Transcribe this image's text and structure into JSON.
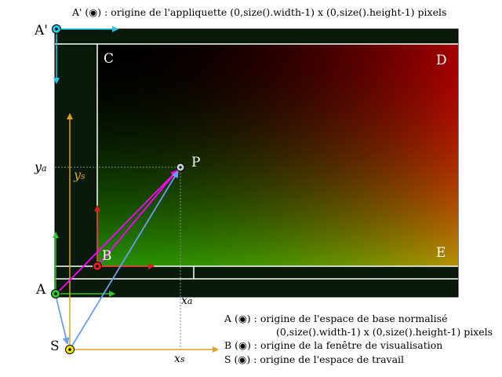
{
  "caption_top": "A' (◉) : origine de l'appliquette  (0,size().width-1) x (0,size().height-1) pixels",
  "points": {
    "A_prime": "A'",
    "A": "A",
    "B": "B",
    "C": "C",
    "D": "D",
    "E": "E",
    "P": "P",
    "S": "S"
  },
  "axes": {
    "ya": "y",
    "ya_sub": "a",
    "ys": "y",
    "ys_sub": "s",
    "xa": "x",
    "xa_sub": "a",
    "xs": "x",
    "xs_sub": "s"
  },
  "legend": {
    "line1": "A  (◉) : origine de l'espace de base normalisé",
    "line2": "(0,size().width-1) x (0,size().height-1) pixels",
    "line3": "B  (◉) : origine de la fenêtre de visualisation",
    "line4": "S  (◉) : origine de l'espace de travail"
  },
  "colors": {
    "cyan": "#22c8e6",
    "green": "#2ec82e",
    "red": "#e02020",
    "yellow": "#f2e600",
    "orange": "#e0a020",
    "magenta": "#ff00ff",
    "blue": "#6a9ef0",
    "dark_bg": "#0a1a0a"
  }
}
